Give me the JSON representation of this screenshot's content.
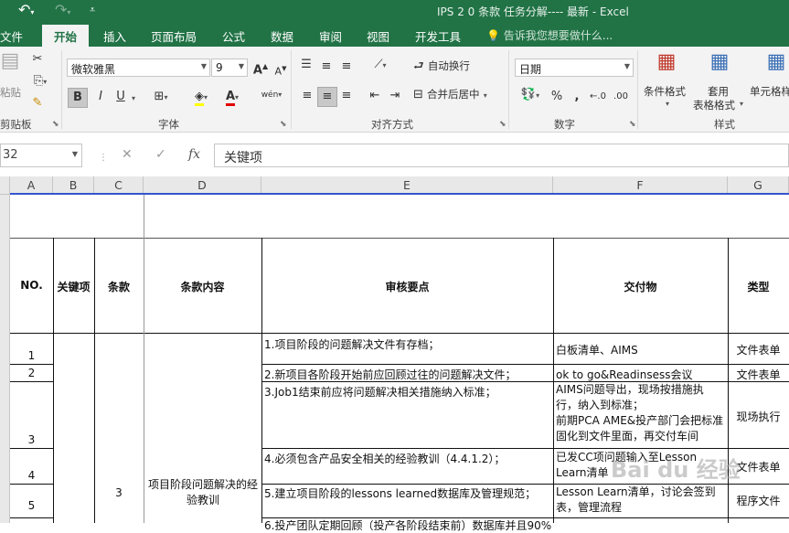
{
  "titlebar": {
    "undo_icon": "undo-icon",
    "redo_icon": "redo-icon",
    "title": "IPS 2 0 条款 任务分解---- 最新 - Excel"
  },
  "tabs": {
    "file": "文件",
    "home": "开始",
    "insert": "插入",
    "page_layout": "页面布局",
    "formulas": "公式",
    "data": "数据",
    "review": "审阅",
    "view": "视图",
    "developer": "开发工具",
    "tell_me": "告诉我您想要做什么..."
  },
  "ribbon": {
    "clipboard": {
      "paste": "粘贴",
      "group": "剪贴板"
    },
    "font": {
      "name": "微软雅黑",
      "size": "9",
      "bold": "B",
      "italic": "I",
      "underline": "U",
      "group": "字体",
      "grow": "A",
      "shrink": "A",
      "font_color": "A",
      "phonetic": "wén"
    },
    "alignment": {
      "wrap": "自动换行",
      "merge": "合并后居中",
      "group": "对齐方式"
    },
    "number": {
      "format": "日期",
      "percent": "%",
      "comma": ",",
      "group": "数字"
    },
    "styles": {
      "conditional": "条件格式",
      "table_l1": "套用",
      "table_l2": "表格格式",
      "cell_styles": "单元格样",
      "group": "样式"
    }
  },
  "formula_bar": {
    "name_box": "32",
    "cancel": "✕",
    "enter": "✓",
    "fx": "fx",
    "content": "关键项"
  },
  "columns": [
    "A",
    "B",
    "C",
    "D",
    "E",
    "F",
    "G"
  ],
  "table": {
    "headers": {
      "no": "NO.",
      "key": "关键项",
      "clause": "条款",
      "clause_content": "条款内容",
      "review_points": "审核要点",
      "deliverables": "交付物",
      "type": "类型"
    },
    "merged_c": "3",
    "merged_d": "项目阶段问题解决的经验教训",
    "rows": [
      {
        "no": "1",
        "review": "1.项目阶段的问题解决文件有存档；",
        "deliverable": "白板清单、AIMS",
        "type": "文件表单"
      },
      {
        "no": "2",
        "review": "2.新项目各阶段开始前应回顾过往的问题解决文件；",
        "deliverable": "ok to go&Readinsess会议",
        "type": "文件表单"
      },
      {
        "no": "3",
        "review": "3.Job1结束前应将问题解决相关措施纳入标准；",
        "deliverable_lines": [
          "AIMS问题导出，现场按措施执",
          "行，纳入到标准；",
          "前期PCA AME&投产部门会把标准",
          "固化到文件里面，再交付车间"
        ],
        "type": "现场执行"
      },
      {
        "no": "4",
        "review": "4.必须包含产品安全相关的经验教训（4.4.1.2）；",
        "deliverable_lines": [
          "已发CC项问题输入至Lesson",
          "Learn清单"
        ],
        "type": "文件表单"
      },
      {
        "no": "5",
        "review": "5.建立项目阶段的lessons learned数据库及管理规范；",
        "deliverable_lines": [
          "Lesson Learn清单，讨论会签到",
          "表，管理流程"
        ],
        "type": "程序文件"
      },
      {
        "no": "",
        "review": "6.投产团队定期回顾（投产各阶段结束前）数据库并且90%",
        "deliverable": "",
        "type": ""
      }
    ]
  },
  "watermark": "Bai du 经验"
}
